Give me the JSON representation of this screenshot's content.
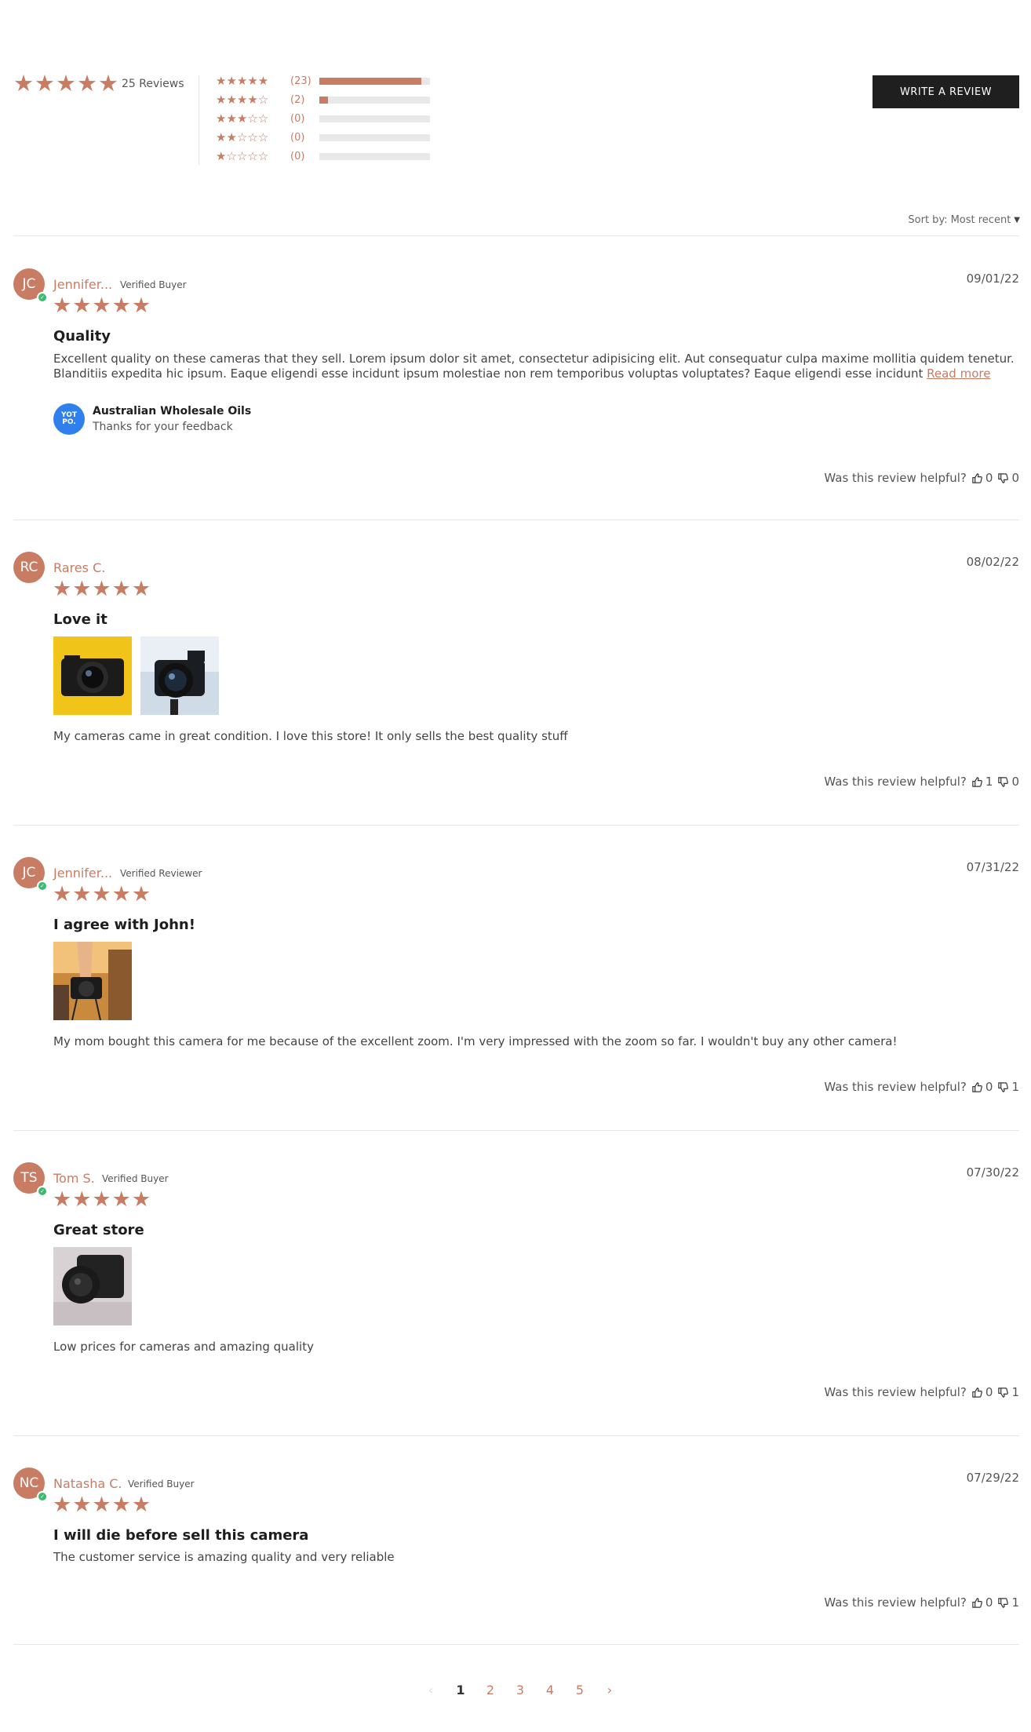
{
  "summary": {
    "average_stars": "★★★★★",
    "total_reviews": "25 Reviews",
    "distribution": [
      {
        "stars": "★★★★★",
        "count": "(23)",
        "fraction": 0.92
      },
      {
        "stars": "★★★★☆",
        "count": "(2)",
        "fraction": 0.08
      },
      {
        "stars": "★★★☆☆",
        "count": "(0)",
        "fraction": 0
      },
      {
        "stars": "★★☆☆☆",
        "count": "(0)",
        "fraction": 0
      },
      {
        "stars": "★☆☆☆☆",
        "count": "(0)",
        "fraction": 0
      }
    ]
  },
  "write_review_label": "WRITE A REVIEW",
  "sort": {
    "label": "Sort by:",
    "value": "Most recent"
  },
  "accent_color": "#c87c63",
  "reviews": [
    {
      "initials": "JC",
      "verified_icon": true,
      "name": "Jennifer...",
      "badge": "Verified Buyer",
      "date": "09/01/22",
      "stars": "★★★★★",
      "title": "Quality",
      "body": "Excellent quality on these cameras that they sell. Lorem ipsum dolor sit amet, consectetur adipisicing elit. Aut consequatur culpa maxime mollitia quidem tenetur. Blanditiis expedita hic ipsum. Eaque eligendi esse incidunt ipsum molestiae non rem temporibus voluptas voluptates?  Eaque eligendi esse incidunt",
      "read_more": "Read more",
      "reply": {
        "logo": "YOT PO.",
        "name": "Australian Wholesale Oils",
        "text": "Thanks for your feedback"
      },
      "helpful_label": "Was this review helpful?",
      "up_votes": "0",
      "down_votes": "0"
    },
    {
      "initials": "RC",
      "verified_icon": false,
      "name": "Rares C.",
      "badge": "",
      "date": "08/02/22",
      "stars": "★★★★★",
      "title": "Love it",
      "images": [
        "compact-camera-photo",
        "dslr-camera-photo"
      ],
      "body": "My cameras came in great condition. I love this store! It only sells the best quality stuff",
      "helpful_label": "Was this review helpful?",
      "up_votes": "1",
      "down_votes": "0"
    },
    {
      "initials": "JC",
      "verified_icon": true,
      "name": "Jennifer...",
      "badge": "Verified Reviewer",
      "date": "07/31/22",
      "stars": "★★★★★",
      "title": "I agree with John!",
      "images": [
        "hand-holding-camera-photo"
      ],
      "body": "My mom bought this camera for me because of the excellent zoom. I'm very impressed with the zoom so far. I wouldn't buy any other camera!",
      "helpful_label": "Was this review helpful?",
      "up_votes": "0",
      "down_votes": "1"
    },
    {
      "initials": "TS",
      "verified_icon": true,
      "name": "Tom S.",
      "badge": "Verified Buyer",
      "date": "07/30/22",
      "stars": "★★★★★",
      "title": "Great store",
      "images": [
        "camera-on-table-photo"
      ],
      "body": "Low prices for cameras and amazing quality",
      "helpful_label": "Was this review helpful?",
      "up_votes": "0",
      "down_votes": "1"
    },
    {
      "initials": "NC",
      "verified_icon": true,
      "name": "Natasha C.",
      "badge": "Verified Buyer",
      "date": "07/29/22",
      "stars": "★★★★★",
      "title": "I will die before sell this camera",
      "body": "The customer service is amazing quality and very reliable",
      "helpful_label": "Was this review helpful?",
      "up_votes": "0",
      "down_votes": "1"
    }
  ],
  "pagination": {
    "prev": "‹",
    "pages": [
      "1",
      "2",
      "3",
      "4",
      "5"
    ],
    "current": "1",
    "next": "›"
  }
}
